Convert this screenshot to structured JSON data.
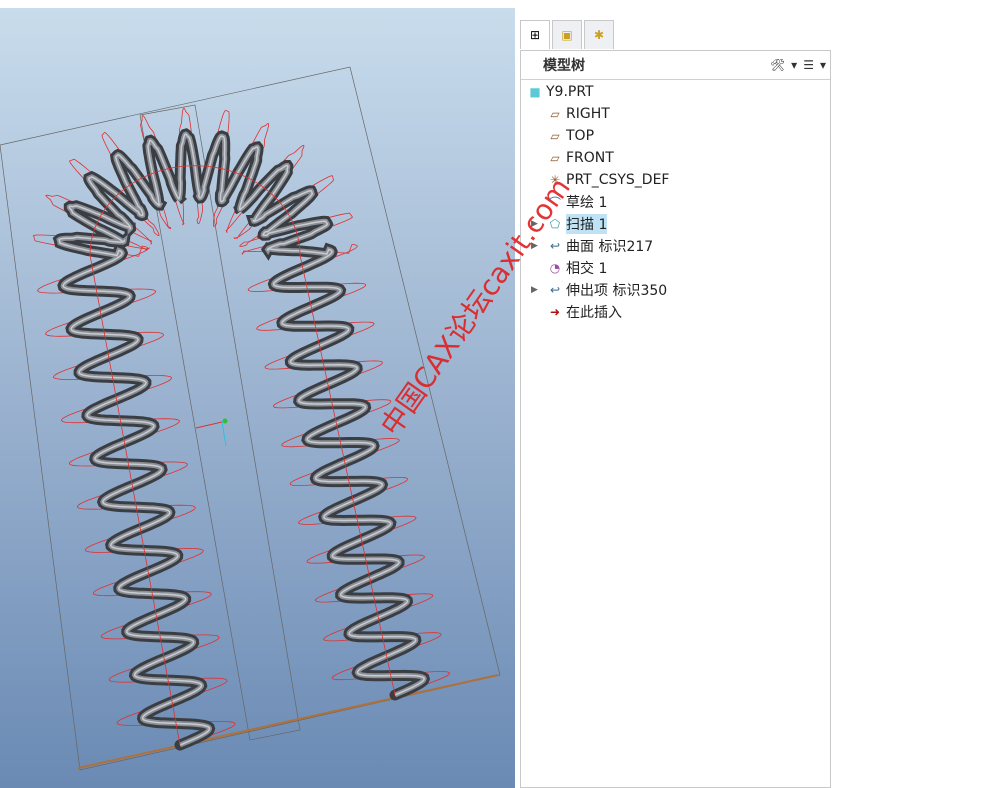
{
  "panel": {
    "tabs": [
      {
        "icon": "model-tree-icon"
      },
      {
        "icon": "folders-icon"
      },
      {
        "icon": "favorites-folder-icon"
      }
    ],
    "title": "模型树",
    "tools": {
      "settings": "🛠",
      "settings_dd": "▾",
      "show": "☰",
      "show_dd": "▾"
    },
    "items": [
      {
        "label": "Y9.PRT",
        "icon": "part-icon",
        "glyph": "■",
        "color": "#5cc8d8",
        "expand": ""
      },
      {
        "label": "RIGHT",
        "icon": "datum-plane-icon",
        "glyph": "▱",
        "color": "#8a5a2a",
        "expand": ""
      },
      {
        "label": "TOP",
        "icon": "datum-plane-icon",
        "glyph": "▱",
        "color": "#8a5a2a",
        "expand": ""
      },
      {
        "label": "FRONT",
        "icon": "datum-plane-icon",
        "glyph": "▱",
        "color": "#8a5a2a",
        "expand": ""
      },
      {
        "label": "PRT_CSYS_DEF",
        "icon": "csys-icon",
        "glyph": "✳",
        "color": "#8a5a2a",
        "expand": ""
      },
      {
        "label": "草绘 1",
        "icon": "sketch-icon",
        "glyph": "⌒",
        "color": "#2a7ab0",
        "expand": ""
      },
      {
        "label": "扫描 1",
        "icon": "sweep-icon",
        "glyph": "⬠",
        "color": "#3aa0b0",
        "expand": "▶",
        "selected": true
      },
      {
        "label": "曲面 标识217",
        "icon": "surface-icon",
        "glyph": "↩",
        "color": "#3a6a8a",
        "expand": "▶"
      },
      {
        "label": "相交 1",
        "icon": "intersect-icon",
        "glyph": "◔",
        "color": "#9a4aa0",
        "expand": ""
      },
      {
        "label": "伸出项 标识350",
        "icon": "protrusion-icon",
        "glyph": "↩",
        "color": "#3a6a8a",
        "expand": "▶"
      },
      {
        "label": "在此插入",
        "icon": "insert-here-arrow-icon",
        "glyph": "➜",
        "color": "#b01010",
        "expand": ""
      }
    ]
  },
  "watermark": "中国CAX论坛caxit.com"
}
